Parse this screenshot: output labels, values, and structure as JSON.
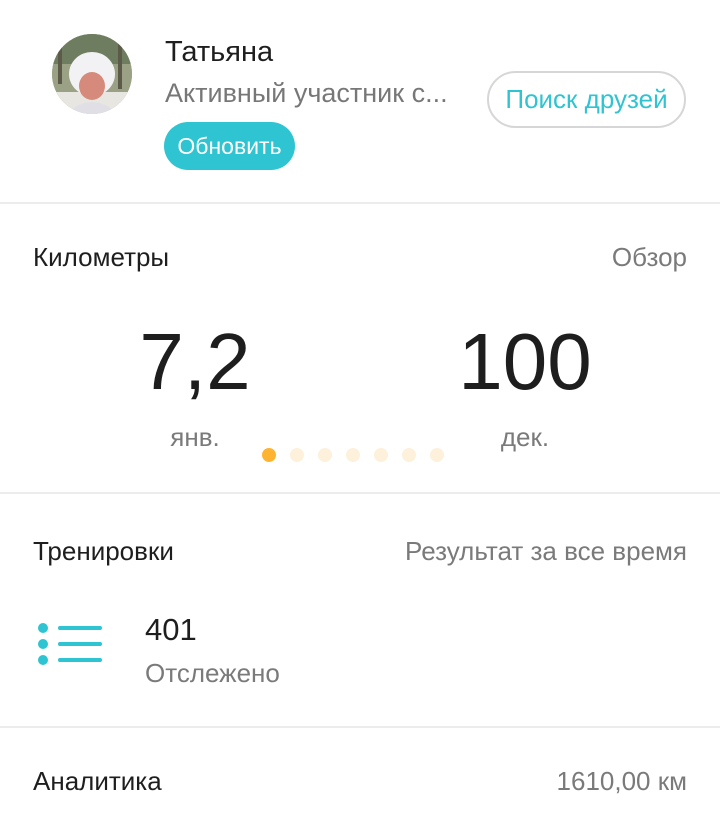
{
  "profile": {
    "name": "Татьяна",
    "subtitle": "Активный участник с...",
    "update_label": "Обновить",
    "find_friends_label": "Поиск друзей"
  },
  "kilometers": {
    "title": "Километры",
    "overview_label": "Обзор",
    "left_value": "7,2",
    "left_month": "янв.",
    "right_value": "100",
    "right_month": "дек.",
    "page_count": 7,
    "active_page": 1
  },
  "workouts": {
    "title": "Тренировки",
    "right_label": "Результат за все время",
    "count": "401",
    "count_label": "Отслежено"
  },
  "analytics": {
    "title": "Аналитика",
    "value": "1610,00 км"
  },
  "colors": {
    "accent": "#2ec4d1",
    "active_dot": "#ffb431",
    "inactive_dot": "#fdf1dc"
  },
  "icons": {
    "avatar": "user-photo",
    "workouts": "list-icon"
  }
}
